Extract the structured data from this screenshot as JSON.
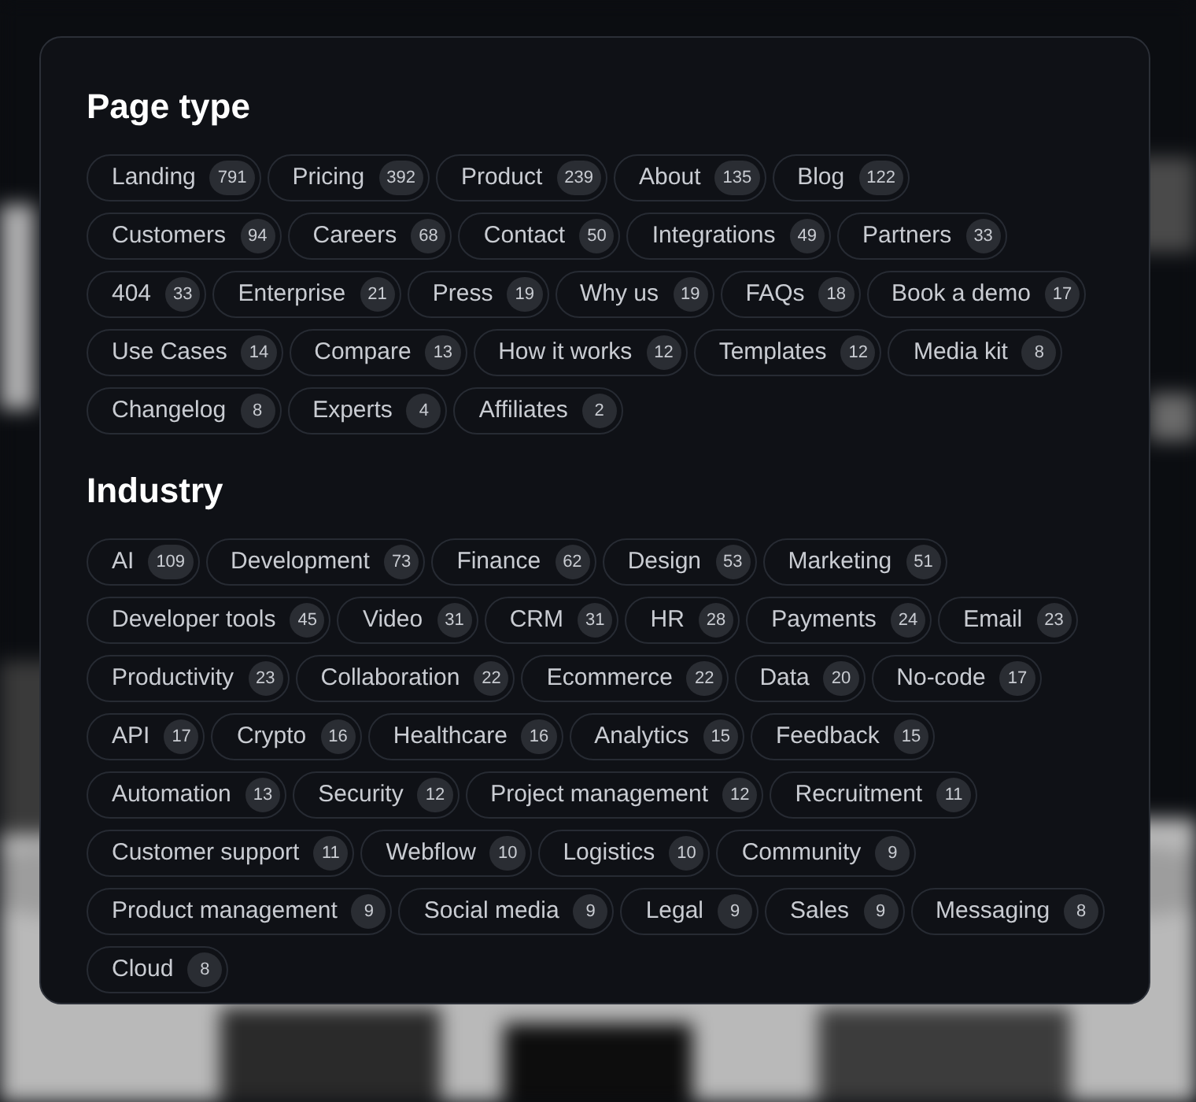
{
  "sections": [
    {
      "title": "Page type",
      "tags": [
        {
          "label": "Landing",
          "count": "791"
        },
        {
          "label": "Pricing",
          "count": "392"
        },
        {
          "label": "Product",
          "count": "239"
        },
        {
          "label": "About",
          "count": "135"
        },
        {
          "label": "Blog",
          "count": "122"
        },
        {
          "label": "Customers",
          "count": "94"
        },
        {
          "label": "Careers",
          "count": "68"
        },
        {
          "label": "Contact",
          "count": "50"
        },
        {
          "label": "Integrations",
          "count": "49"
        },
        {
          "label": "Partners",
          "count": "33"
        },
        {
          "label": "404",
          "count": "33"
        },
        {
          "label": "Enterprise",
          "count": "21"
        },
        {
          "label": "Press",
          "count": "19"
        },
        {
          "label": "Why us",
          "count": "19"
        },
        {
          "label": "FAQs",
          "count": "18"
        },
        {
          "label": "Book a demo",
          "count": "17"
        },
        {
          "label": "Use Cases",
          "count": "14"
        },
        {
          "label": "Compare",
          "count": "13"
        },
        {
          "label": "How it works",
          "count": "12"
        },
        {
          "label": "Templates",
          "count": "12"
        },
        {
          "label": "Media kit",
          "count": "8"
        },
        {
          "label": "Changelog",
          "count": "8"
        },
        {
          "label": "Experts",
          "count": "4"
        },
        {
          "label": "Affiliates",
          "count": "2"
        }
      ]
    },
    {
      "title": "Industry",
      "tags": [
        {
          "label": "AI",
          "count": "109"
        },
        {
          "label": "Development",
          "count": "73"
        },
        {
          "label": "Finance",
          "count": "62"
        },
        {
          "label": "Design",
          "count": "53"
        },
        {
          "label": "Marketing",
          "count": "51"
        },
        {
          "label": "Developer tools",
          "count": "45"
        },
        {
          "label": "Video",
          "count": "31"
        },
        {
          "label": "CRM",
          "count": "31"
        },
        {
          "label": "HR",
          "count": "28"
        },
        {
          "label": "Payments",
          "count": "24"
        },
        {
          "label": "Email",
          "count": "23"
        },
        {
          "label": "Productivity",
          "count": "23"
        },
        {
          "label": "Collaboration",
          "count": "22"
        },
        {
          "label": "Ecommerce",
          "count": "22"
        },
        {
          "label": "Data",
          "count": "20"
        },
        {
          "label": "No-code",
          "count": "17"
        },
        {
          "label": "API",
          "count": "17"
        },
        {
          "label": "Crypto",
          "count": "16"
        },
        {
          "label": "Healthcare",
          "count": "16"
        },
        {
          "label": "Analytics",
          "count": "15"
        },
        {
          "label": "Feedback",
          "count": "15"
        },
        {
          "label": "Automation",
          "count": "13"
        },
        {
          "label": "Security",
          "count": "12"
        },
        {
          "label": "Project management",
          "count": "12"
        },
        {
          "label": "Recruitment",
          "count": "11"
        },
        {
          "label": "Customer support",
          "count": "11"
        },
        {
          "label": "Webflow",
          "count": "10"
        },
        {
          "label": "Logistics",
          "count": "10"
        },
        {
          "label": "Community",
          "count": "9"
        },
        {
          "label": "Product management",
          "count": "9"
        },
        {
          "label": "Social media",
          "count": "9"
        },
        {
          "label": "Legal",
          "count": "9"
        },
        {
          "label": "Sales",
          "count": "9"
        },
        {
          "label": "Messaging",
          "count": "8"
        },
        {
          "label": "Cloud",
          "count": "8"
        }
      ]
    }
  ]
}
